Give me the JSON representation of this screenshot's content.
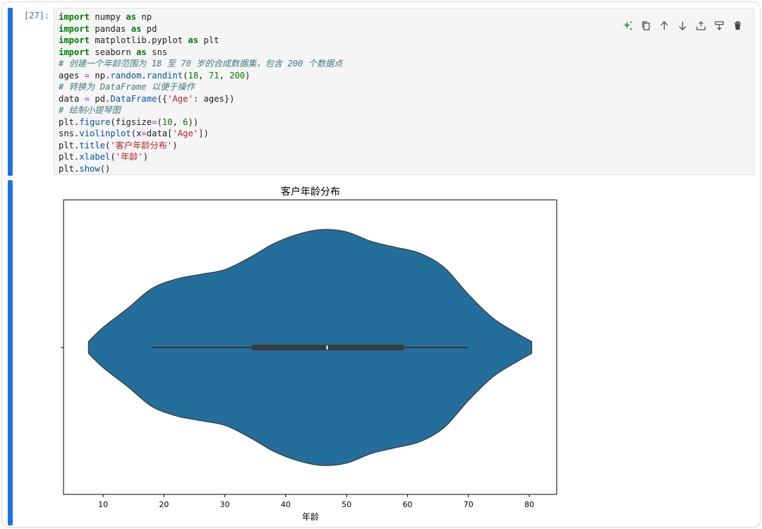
{
  "cell": {
    "prompt": "[27]:",
    "code_lines": [
      [
        {
          "t": "kw",
          "v": "import"
        },
        {
          "t": "",
          "v": " numpy "
        },
        {
          "t": "kw",
          "v": "as"
        },
        {
          "t": "",
          "v": " np"
        }
      ],
      [
        {
          "t": "kw",
          "v": "import"
        },
        {
          "t": "",
          "v": " pandas "
        },
        {
          "t": "kw",
          "v": "as"
        },
        {
          "t": "",
          "v": " pd"
        }
      ],
      [
        {
          "t": "kw",
          "v": "import"
        },
        {
          "t": "",
          "v": " matplotlib.pyplot "
        },
        {
          "t": "kw",
          "v": "as"
        },
        {
          "t": "",
          "v": " plt"
        }
      ],
      [
        {
          "t": "kw",
          "v": "import"
        },
        {
          "t": "",
          "v": " seaborn "
        },
        {
          "t": "kw",
          "v": "as"
        },
        {
          "t": "",
          "v": " sns"
        }
      ],
      [
        {
          "t": "cm",
          "v": "# 创建一个年龄范围为 18 至 70 岁的合成数据集，包含 200 个数据点"
        }
      ],
      [
        {
          "t": "",
          "v": "ages "
        },
        {
          "t": "op",
          "v": "="
        },
        {
          "t": "",
          "v": " np."
        },
        {
          "t": "fn",
          "v": "random"
        },
        {
          "t": "",
          "v": "."
        },
        {
          "t": "fn",
          "v": "randint"
        },
        {
          "t": "",
          "v": "("
        },
        {
          "t": "num",
          "v": "18"
        },
        {
          "t": "",
          "v": ", "
        },
        {
          "t": "num",
          "v": "71"
        },
        {
          "t": "",
          "v": ", "
        },
        {
          "t": "num",
          "v": "200"
        },
        {
          "t": "",
          "v": ")"
        }
      ],
      [
        {
          "t": "cm",
          "v": "# 转换为 DataFrame 以便于操作"
        }
      ],
      [
        {
          "t": "",
          "v": "data "
        },
        {
          "t": "op",
          "v": "="
        },
        {
          "t": "",
          "v": " pd."
        },
        {
          "t": "fn",
          "v": "DataFrame"
        },
        {
          "t": "",
          "v": "({"
        },
        {
          "t": "str",
          "v": "'Age'"
        },
        {
          "t": "",
          "v": ": ages})"
        }
      ],
      [
        {
          "t": "cm",
          "v": "# 绘制小提琴图"
        }
      ],
      [
        {
          "t": "",
          "v": "plt."
        },
        {
          "t": "fn",
          "v": "figure"
        },
        {
          "t": "",
          "v": "(figsize"
        },
        {
          "t": "op",
          "v": "="
        },
        {
          "t": "",
          "v": "("
        },
        {
          "t": "num",
          "v": "10"
        },
        {
          "t": "",
          "v": ", "
        },
        {
          "t": "num",
          "v": "6"
        },
        {
          "t": "",
          "v": "))"
        }
      ],
      [
        {
          "t": "",
          "v": "sns."
        },
        {
          "t": "fn",
          "v": "violinplot"
        },
        {
          "t": "",
          "v": "(x"
        },
        {
          "t": "op",
          "v": "="
        },
        {
          "t": "",
          "v": "data["
        },
        {
          "t": "str",
          "v": "'Age'"
        },
        {
          "t": "",
          "v": "])"
        }
      ],
      [
        {
          "t": "",
          "v": "plt."
        },
        {
          "t": "fn",
          "v": "title"
        },
        {
          "t": "",
          "v": "("
        },
        {
          "t": "str",
          "v": "'客户年龄分布'"
        },
        {
          "t": "",
          "v": ")"
        }
      ],
      [
        {
          "t": "",
          "v": "plt."
        },
        {
          "t": "fn",
          "v": "xlabel"
        },
        {
          "t": "",
          "v": "("
        },
        {
          "t": "str",
          "v": "'年龄'"
        },
        {
          "t": "",
          "v": ")"
        }
      ],
      [
        {
          "t": "",
          "v": "plt."
        },
        {
          "t": "fn",
          "v": "show"
        },
        {
          "t": "",
          "v": "()"
        }
      ]
    ],
    "toolbar": [
      "sparkle-icon",
      "duplicate-icon",
      "move-up-icon",
      "move-down-icon",
      "insert-above-icon",
      "insert-below-icon",
      "delete-icon"
    ],
    "colors": {
      "accent": "#1a73e8",
      "sparkle": "#2e9d3a",
      "violin": "#236e9a"
    }
  },
  "chart_data": {
    "type": "violin",
    "title": "客户年龄分布",
    "xlabel": "年龄",
    "ylabel": "",
    "xlim": [
      3.5,
      84.5
    ],
    "xticks": [
      10,
      20,
      30,
      40,
      50,
      60,
      70,
      80
    ],
    "whisker": [
      18,
      70
    ],
    "quartiles": [
      34.5,
      59.3
    ],
    "median": 46.8,
    "density_profile": {
      "x": [
        7.6,
        10,
        14,
        18,
        22,
        26,
        30,
        34,
        38,
        42,
        46,
        50,
        54,
        58,
        62,
        66,
        70,
        74,
        78,
        80.4
      ],
      "halfwidth": [
        0.05,
        0.17,
        0.33,
        0.5,
        0.58,
        0.62,
        0.66,
        0.76,
        0.88,
        0.96,
        1.0,
        0.98,
        0.9,
        0.85,
        0.8,
        0.68,
        0.45,
        0.25,
        0.12,
        0.05
      ]
    }
  }
}
